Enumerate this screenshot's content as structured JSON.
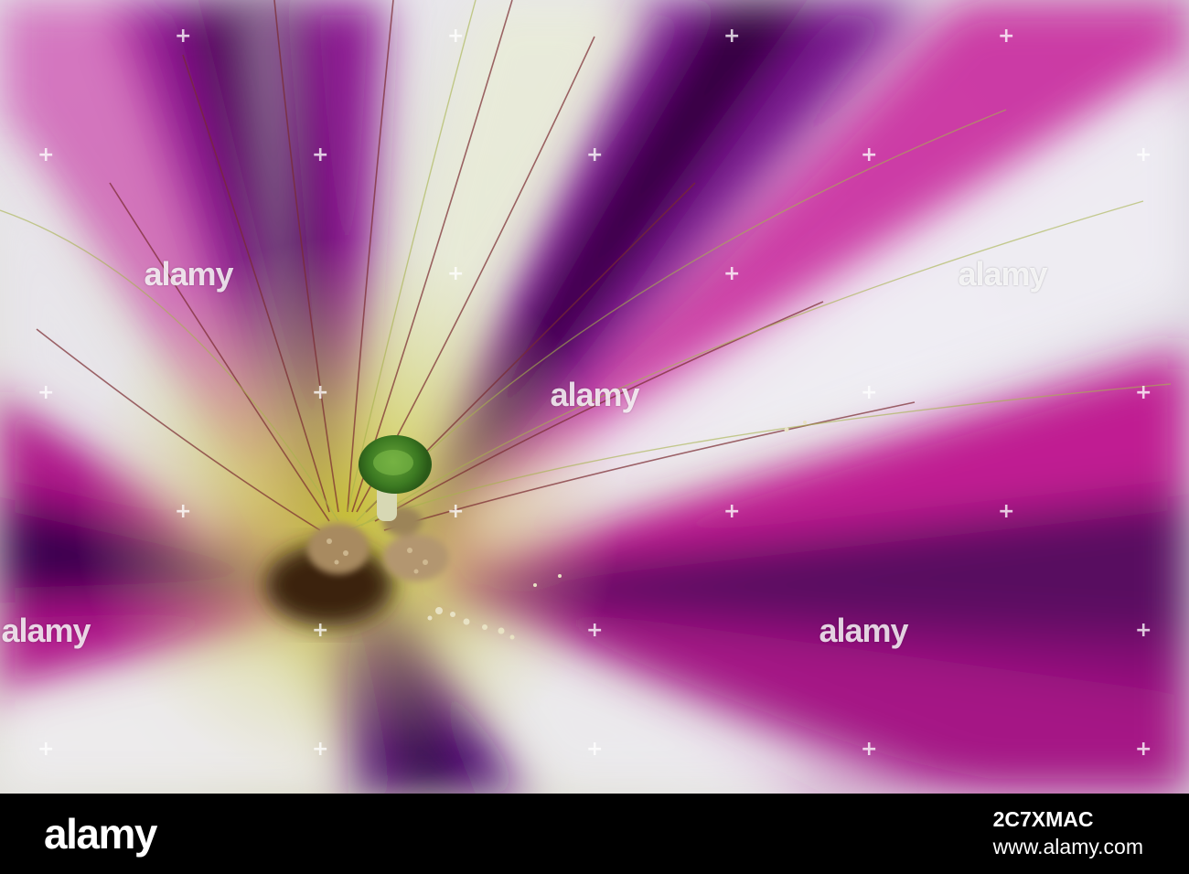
{
  "photo": {
    "subject": "petunia-flower-closeup",
    "colors": {
      "magenta": "#c4168c",
      "purple": "#5a0a6a",
      "white": "#eceaf0",
      "green": "#b7c27a",
      "stigma": "#4d8a2a",
      "anther": "#b89a6f"
    }
  },
  "watermark": {
    "logo_text": "alamy"
  },
  "footer": {
    "brand": "alamy",
    "image_id": "2C7XMAC",
    "site": "www.alamy.com"
  }
}
